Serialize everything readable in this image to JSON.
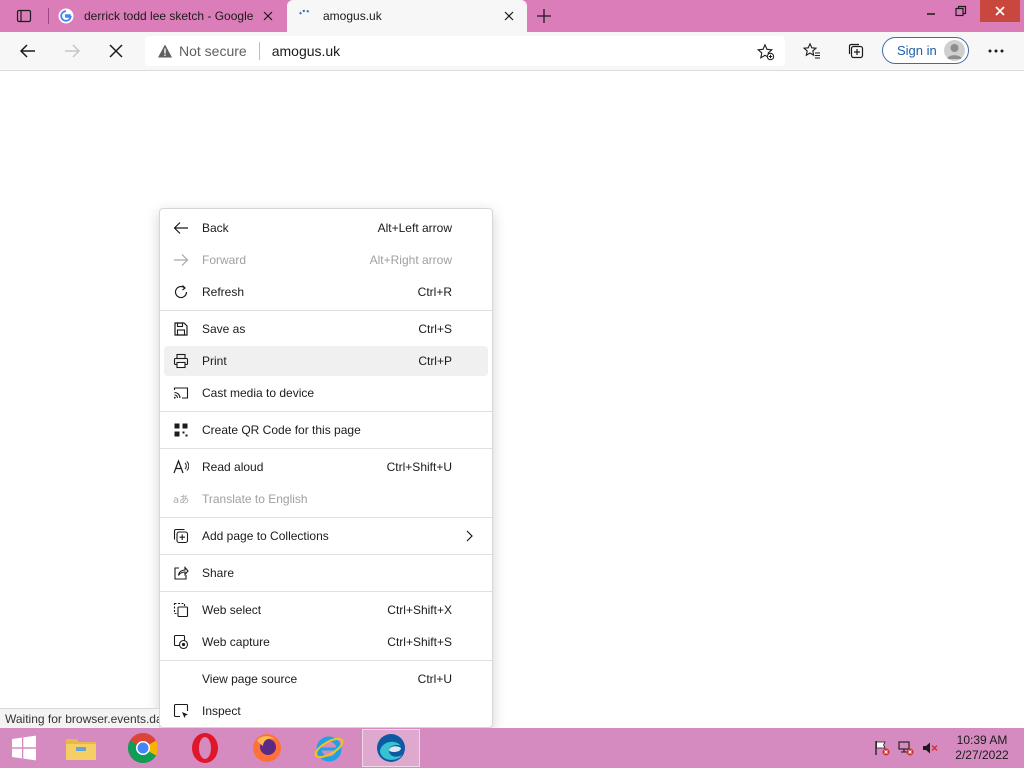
{
  "tabs": [
    {
      "title": "derrick todd lee sketch - Google",
      "favicon": "google-icon",
      "active": false
    },
    {
      "title": "amogus.uk",
      "favicon": "loading-spinner-icon",
      "active": true
    }
  ],
  "address": {
    "warning": "Not secure",
    "url": "amogus.uk"
  },
  "toolbar": {
    "signin_label": "Sign in"
  },
  "context_menu": {
    "items": [
      {
        "label": "Back",
        "shortcut": "Alt+Left arrow",
        "icon": "back-arrow-icon",
        "enabled": true
      },
      {
        "label": "Forward",
        "shortcut": "Alt+Right arrow",
        "icon": "forward-arrow-icon",
        "enabled": false
      },
      {
        "label": "Refresh",
        "shortcut": "Ctrl+R",
        "icon": "refresh-icon",
        "enabled": true
      },
      {
        "label": "Save as",
        "shortcut": "Ctrl+S",
        "icon": "save-icon",
        "enabled": true
      },
      {
        "label": "Print",
        "shortcut": "Ctrl+P",
        "icon": "printer-icon",
        "enabled": true,
        "hovered": true
      },
      {
        "label": "Cast media to device",
        "shortcut": "",
        "icon": "cast-icon",
        "enabled": true
      },
      {
        "label": "Create QR Code for this page",
        "shortcut": "",
        "icon": "qr-code-icon",
        "enabled": true
      },
      {
        "label": "Read aloud",
        "shortcut": "Ctrl+Shift+U",
        "icon": "read-aloud-icon",
        "enabled": true
      },
      {
        "label": "Translate to English",
        "shortcut": "",
        "icon": "translate-icon",
        "enabled": false
      },
      {
        "label": "Add page to Collections",
        "shortcut": "",
        "icon": "collections-add-icon",
        "enabled": true,
        "submenu": true
      },
      {
        "label": "Share",
        "shortcut": "",
        "icon": "share-icon",
        "enabled": true
      },
      {
        "label": "Web select",
        "shortcut": "Ctrl+Shift+X",
        "icon": "web-select-icon",
        "enabled": true
      },
      {
        "label": "Web capture",
        "shortcut": "Ctrl+Shift+S",
        "icon": "web-capture-icon",
        "enabled": true
      },
      {
        "label": "View page source",
        "shortcut": "Ctrl+U",
        "icon": "",
        "enabled": true
      },
      {
        "label": "Inspect",
        "shortcut": "",
        "icon": "inspect-icon",
        "enabled": true
      }
    ]
  },
  "status": "Waiting for browser.events.da",
  "taskbar": {
    "apps": [
      "file-explorer-icon",
      "chrome-icon",
      "opera-icon",
      "firefox-icon",
      "internet-explorer-icon",
      "edge-icon"
    ],
    "time": "10:39 AM",
    "date": "2/27/2022"
  },
  "colors": {
    "titlebar": "#db7db9",
    "taskbar": "#d58bbf",
    "accent": "#1d5fa8"
  }
}
